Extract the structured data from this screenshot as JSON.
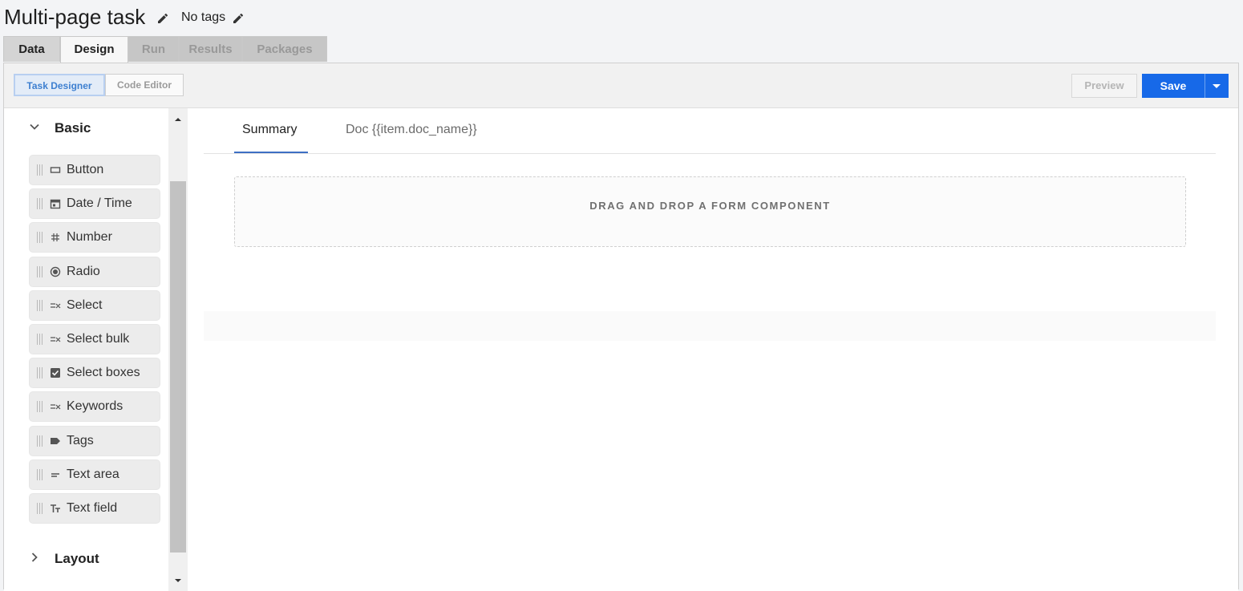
{
  "header": {
    "title": "Multi-page task",
    "tags": "No tags",
    "edit_icon": "pencil-icon"
  },
  "tabs": [
    {
      "label": "Data",
      "state": "inactive"
    },
    {
      "label": "Design",
      "state": "active"
    },
    {
      "label": "Run",
      "state": "disabled"
    },
    {
      "label": "Results",
      "state": "disabled"
    },
    {
      "label": "Packages",
      "state": "disabled"
    }
  ],
  "toolbar": {
    "task_designer": "Task Designer",
    "code_editor": "Code Editor",
    "preview": "Preview",
    "save": "Save"
  },
  "sidebar": {
    "groups": [
      {
        "label": "Basic",
        "expanded": true
      },
      {
        "label": "Layout",
        "expanded": false
      }
    ],
    "components": [
      {
        "label": "Button",
        "icon": "button-icon"
      },
      {
        "label": "Date / Time",
        "icon": "calendar-icon"
      },
      {
        "label": "Number",
        "icon": "hash-icon"
      },
      {
        "label": "Radio",
        "icon": "radio-icon"
      },
      {
        "label": "Select",
        "icon": "select-icon"
      },
      {
        "label": "Select bulk",
        "icon": "select-icon"
      },
      {
        "label": "Select boxes",
        "icon": "checkbox-icon"
      },
      {
        "label": "Keywords",
        "icon": "select-icon"
      },
      {
        "label": "Tags",
        "icon": "tag-icon"
      },
      {
        "label": "Text area",
        "icon": "textarea-icon"
      },
      {
        "label": "Text field",
        "icon": "textfield-icon"
      }
    ]
  },
  "pages": {
    "tabs": [
      "Summary",
      "Doc {{item.doc_name}}"
    ],
    "active": "Summary"
  },
  "dropzone": "DRAG AND DROP A FORM COMPONENT",
  "colors": {
    "accent": "#1769e8",
    "active_tab_underline": "#3d6fc4",
    "background": "#f3f4f6"
  }
}
